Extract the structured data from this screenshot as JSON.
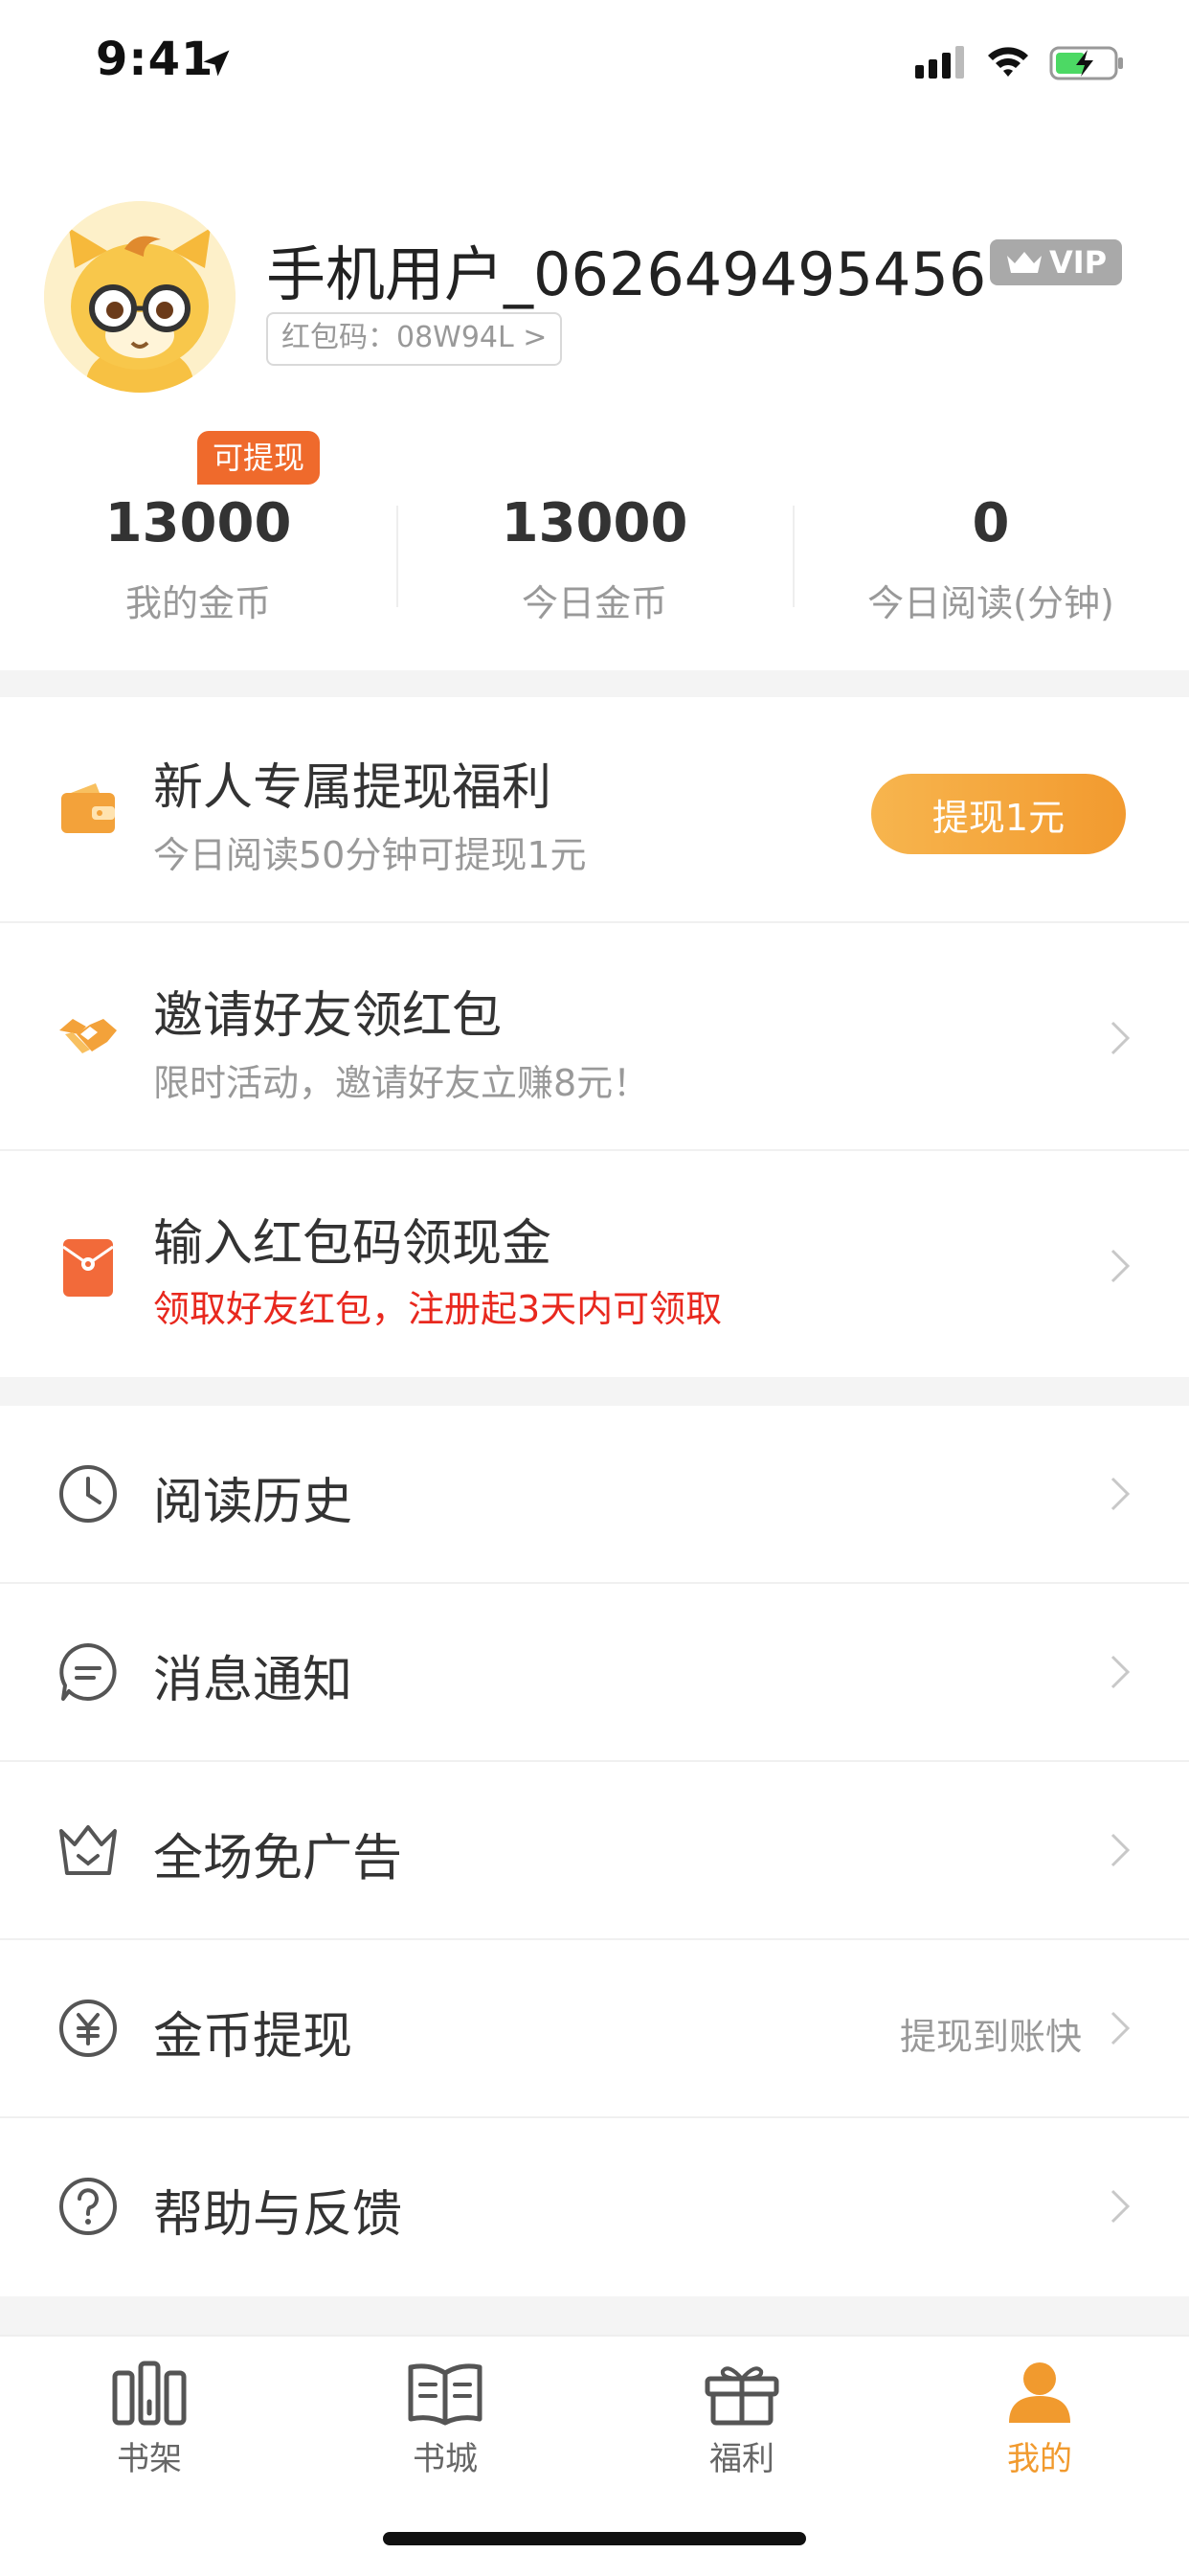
{
  "status_bar": {
    "time": "9:41"
  },
  "profile": {
    "username": "手机用户_062649495456",
    "vip_label": "VIP",
    "red_packet_code": "红包码：08W94L >"
  },
  "stats": {
    "withdraw_tag": "可提现",
    "items": [
      {
        "value": "13000",
        "label": "我的金币"
      },
      {
        "value": "13000",
        "label": "今日金币"
      },
      {
        "value": "0",
        "label": "今日阅读(分钟)"
      }
    ]
  },
  "promos": {
    "newbie": {
      "title": "新人专属提现福利",
      "subtitle": "今日阅读50分钟可提现1元",
      "button": "提现1元"
    },
    "invite": {
      "title": "邀请好友领红包",
      "subtitle": "限时活动，邀请好友立赚8元！"
    },
    "redcode": {
      "title": "输入红包码领现金",
      "subtitle": "领取好友红包，注册起3天内可领取"
    }
  },
  "menu": {
    "history": {
      "label": "阅读历史"
    },
    "messages": {
      "label": "消息通知"
    },
    "no_ads": {
      "label": "全场免广告"
    },
    "coin_withdraw": {
      "label": "金币提现",
      "extra": "提现到账快"
    },
    "help": {
      "label": "帮助与反馈"
    }
  },
  "tabs": [
    {
      "label": "书架",
      "icon": "bookshelf-icon"
    },
    {
      "label": "书城",
      "icon": "book-store-icon"
    },
    {
      "label": "福利",
      "icon": "gift-icon"
    },
    {
      "label": "我的",
      "icon": "user-icon",
      "active": true
    }
  ],
  "colors": {
    "accent": "#f19a2e",
    "tag": "#ef6a2c",
    "warning_text": "#e8281e"
  }
}
